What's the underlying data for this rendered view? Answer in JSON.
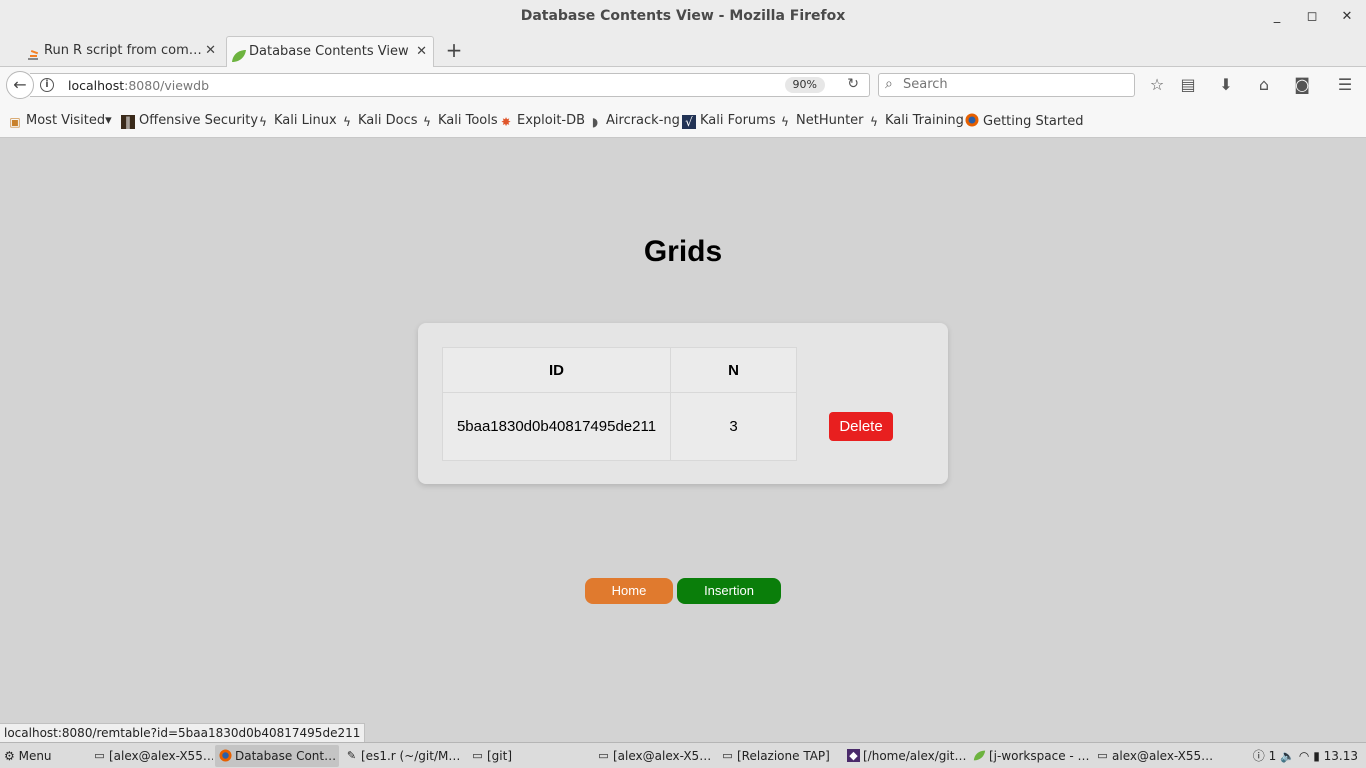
{
  "window": {
    "title": "Database Contents View - Mozilla Firefox",
    "controls": {
      "minimize": "_",
      "maximize": "◻",
      "close": "✕"
    }
  },
  "tabs": [
    {
      "label": "Run R script from com…",
      "icon": "stackoverflow-icon",
      "active": false
    },
    {
      "label": "Database Contents View",
      "icon": "leaf-icon",
      "active": true
    }
  ],
  "newtab": "+",
  "nav": {
    "url_host": "localhost",
    "url_rest": ":8080/viewdb",
    "zoom": "90%",
    "search_placeholder": "Search"
  },
  "bookmarks": [
    {
      "label": "Most Visited",
      "icon": "folder-icon",
      "dropdown": "▾"
    },
    {
      "label": "Offensive Security",
      "icon": "offsec-icon"
    },
    {
      "label": "Kali Linux",
      "icon": "kali-icon"
    },
    {
      "label": "Kali Docs",
      "icon": "kali-icon"
    },
    {
      "label": "Kali Tools",
      "icon": "kali-icon"
    },
    {
      "label": "Exploit-DB",
      "icon": "exploitdb-icon"
    },
    {
      "label": "Aircrack-ng",
      "icon": "aircrack-icon"
    },
    {
      "label": "Kali Forums",
      "icon": "forum-icon"
    },
    {
      "label": "NetHunter",
      "icon": "kali-icon"
    },
    {
      "label": "Kali Training",
      "icon": "kali-icon"
    },
    {
      "label": "Getting Started",
      "icon": "firefox-icon"
    }
  ],
  "page": {
    "heading": "Grids",
    "table": {
      "headers": [
        "ID",
        "N"
      ],
      "rows": [
        {
          "id": "5baa1830d0b40817495de211",
          "n": "3",
          "action": "Delete"
        }
      ]
    },
    "buttons": {
      "home": "Home",
      "insertion": "Insertion"
    },
    "colors": {
      "delete": "#e81f1f",
      "home": "#e07a2e",
      "insertion": "#0a7e0a",
      "background": "#d3d3d3"
    }
  },
  "status_url": "localhost:8080/remtable?id=5baa1830d0b40817495de211",
  "taskbar": {
    "menu": "Menu",
    "items": [
      {
        "label": "[alex@alex-X55…",
        "icon": "terminal-icon"
      },
      {
        "label": "Database Cont…",
        "icon": "firefox-icon",
        "active": true
      },
      {
        "label": "[es1.r (~/git/M…",
        "icon": "editor-icon"
      },
      {
        "label": "[git]",
        "icon": "folder-icon"
      },
      {
        "label": "[alex@alex-X5…",
        "icon": "terminal-icon"
      },
      {
        "label": "[Relazione TAP]",
        "icon": "folder-icon"
      },
      {
        "label": "[/home/alex/git…",
        "icon": "app-icon"
      },
      {
        "label": "[j-workspace - …",
        "icon": "spring-icon"
      },
      {
        "label": "alex@alex-X55…",
        "icon": "terminal-icon"
      }
    ],
    "tray": {
      "notifications": "1",
      "clock": "13.13"
    }
  }
}
